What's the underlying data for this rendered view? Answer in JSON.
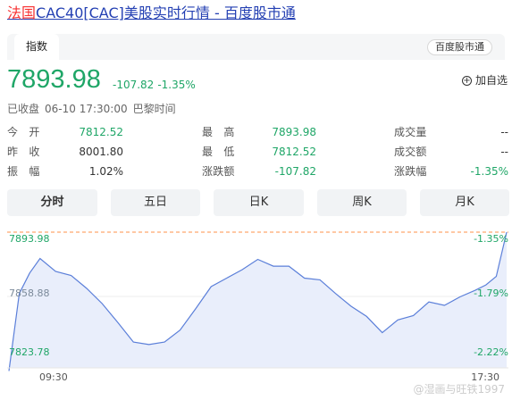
{
  "title": {
    "highlight": "法国",
    "rest": "CAC40[CAC]美股实时行情 - 百度股市通"
  },
  "tabs": {
    "active": "指数",
    "source_badge": "百度股市通"
  },
  "quote": {
    "price": "7893.98",
    "change": "-107.82",
    "change_pct": "-1.35%",
    "fav_label": "加自选",
    "status": "已收盘",
    "datetime": "06-10 17:30:00",
    "timezone": "巴黎时间"
  },
  "stats": [
    {
      "label": "今　开",
      "value": "7812.52"
    },
    {
      "label": "最　高",
      "value": "7893.98"
    },
    {
      "label": "成交量",
      "value": "--"
    },
    {
      "label": "昨　收",
      "value": "8001.80"
    },
    {
      "label": "最　低",
      "value": "7812.52"
    },
    {
      "label": "成交额",
      "value": "--"
    },
    {
      "label": "振　幅",
      "value": "1.02%"
    },
    {
      "label": "涨跌额",
      "value": "-107.82"
    },
    {
      "label": "涨跌幅",
      "value": "-1.35%"
    }
  ],
  "period_tabs": [
    "分时",
    "五日",
    "日K",
    "周K",
    "月K"
  ],
  "active_period": "分时",
  "chart": {
    "y_top": "7893.98",
    "y_mid": "7858.88",
    "y_bottom": "7823.78",
    "pct_top": "-1.35%",
    "pct_mid": "-1.79%",
    "pct_bottom": "-2.22%",
    "x_start": "09:30",
    "x_end": "17:30",
    "colors": {
      "line": "#5b7fd9",
      "fill": "#e9eefb",
      "high_line": "#ff9248",
      "green": "#1fa667"
    }
  },
  "chart_data": {
    "type": "area",
    "x_range": [
      "09:30",
      "17:30"
    ],
    "ylim": [
      7823.78,
      7893.98
    ],
    "series": [
      {
        "x": [
          "09:30",
          "09:40",
          "09:50",
          "10:00",
          "10:15",
          "10:30",
          "10:45",
          "11:00",
          "11:15",
          "11:30",
          "11:45",
          "12:00",
          "12:15",
          "12:30",
          "12:45",
          "13:00",
          "13:15",
          "13:30",
          "13:45",
          "14:00",
          "14:15",
          "14:30",
          "14:45",
          "15:00",
          "15:15",
          "15:30",
          "15:45",
          "16:00",
          "16:15",
          "16:30",
          "16:45",
          "17:00",
          "17:10",
          "17:20",
          "17:30"
        ],
        "values": [
          7812.5,
          7858.0,
          7870.0,
          7878.5,
          7871.0,
          7868.5,
          7861.0,
          7852.0,
          7841.0,
          7829.5,
          7828.0,
          7829.5,
          7836.5,
          7849.0,
          7862.0,
          7867.0,
          7872.0,
          7878.0,
          7874.0,
          7874.0,
          7867.0,
          7866.0,
          7858.0,
          7850.5,
          7844.5,
          7835.0,
          7842.5,
          7845.0,
          7853.0,
          7851.0,
          7856.0,
          7860.0,
          7863.0,
          7868.0,
          7893.98
        ]
      }
    ]
  },
  "watermark": "@湿画与旺铁1997"
}
